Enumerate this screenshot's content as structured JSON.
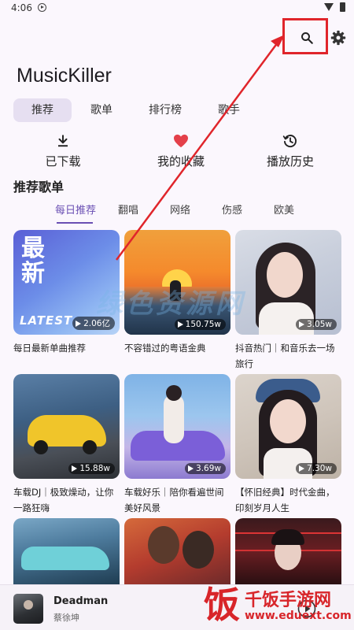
{
  "status_bar": {
    "time": "4:06"
  },
  "app": {
    "title": "MusicKiller"
  },
  "top_tabs": [
    {
      "label": "推荐",
      "active": true
    },
    {
      "label": "歌单",
      "active": false
    },
    {
      "label": "排行榜",
      "active": false
    },
    {
      "label": "歌手",
      "active": false
    }
  ],
  "quick_actions": [
    {
      "label": "已下载",
      "icon": "download-icon"
    },
    {
      "label": "我的收藏",
      "icon": "heart-icon"
    },
    {
      "label": "播放历史",
      "icon": "history-icon"
    }
  ],
  "section": {
    "title": "推荐歌单"
  },
  "category_tabs": [
    {
      "label": "每日推荐",
      "active": true
    },
    {
      "label": "翻唱",
      "active": false
    },
    {
      "label": "网络",
      "active": false
    },
    {
      "label": "伤感",
      "active": false
    },
    {
      "label": "欧美",
      "active": false
    }
  ],
  "playlists": [
    {
      "title": "每日最新单曲推荐",
      "plays": "2.06亿",
      "cover_text_1": "最",
      "cover_text_2": "新",
      "cover_text_3": "LATEST"
    },
    {
      "title": "不容错过的粤语金典",
      "plays": "150.75w"
    },
    {
      "title": "抖音热门｜和音乐去一场旅行",
      "plays": "3.05w"
    },
    {
      "title": "车载DJ｜极致燥动，让你一路狂嗨",
      "plays": "15.88w"
    },
    {
      "title": "车载好乐｜陪你看遍世间美好风景",
      "plays": "3.69w"
    },
    {
      "title": "【怀旧经典】时代金曲，印刻岁月人生",
      "plays": "7.30w"
    },
    {
      "title": "",
      "plays": ""
    },
    {
      "title": "",
      "plays": ""
    },
    {
      "title": "",
      "plays": ""
    }
  ],
  "mini_player": {
    "title": "Deadman",
    "artist": "蔡徐坤"
  },
  "watermark": {
    "center": "绿色资源网",
    "logo_char": "饭",
    "brand": "千饭手游网",
    "url": "www.eduext.com"
  },
  "colors": {
    "accent": "#6a4fb3",
    "highlight": "#e0252b",
    "heart": "#e4404a"
  }
}
